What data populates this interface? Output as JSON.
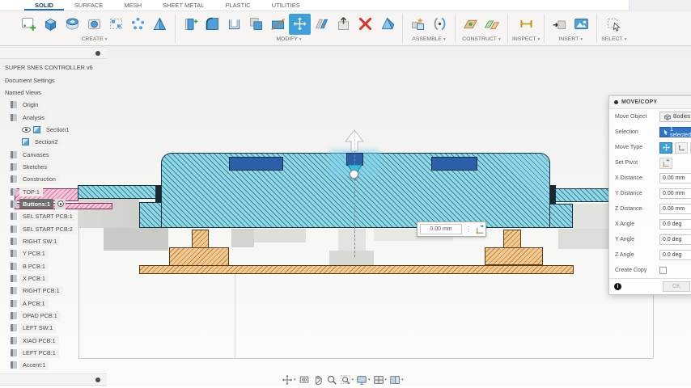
{
  "ribbon": {
    "tabs": [
      {
        "label": "SOLID",
        "active": true
      },
      {
        "label": "SURFACE",
        "active": false
      },
      {
        "label": "MESH",
        "active": false
      },
      {
        "label": "SHEET METAL",
        "active": false
      },
      {
        "label": "PLASTIC",
        "active": false
      },
      {
        "label": "UTILITIES",
        "active": false
      }
    ],
    "groups": [
      {
        "label": "CREATE"
      },
      {
        "label": "MODIFY"
      },
      {
        "label": "ASSEMBLE"
      },
      {
        "label": "CONSTRUCT"
      },
      {
        "label": "INSPECT"
      },
      {
        "label": "INSERT"
      },
      {
        "label": "SELECT"
      }
    ]
  },
  "browser": {
    "items": [
      {
        "label": "SUPER SNES CONTROLLER v6",
        "type": "doc"
      },
      {
        "label": "Document Settings",
        "type": "folder"
      },
      {
        "label": "Named Views",
        "type": "folder"
      },
      {
        "label": "Origin",
        "type": "node"
      },
      {
        "label": "Analysis",
        "type": "node"
      },
      {
        "label": "Section1",
        "type": "section",
        "eye": true
      },
      {
        "label": "Section2",
        "type": "section",
        "eye": false
      },
      {
        "label": "Canvases",
        "type": "node"
      },
      {
        "label": "Sketches",
        "type": "node"
      },
      {
        "label": "Construction",
        "type": "node"
      },
      {
        "label": "TOP:1",
        "type": "component"
      },
      {
        "label": "Buttons:1",
        "type": "component",
        "selected": true
      },
      {
        "label": "SEL START PCB:1",
        "type": "component"
      },
      {
        "label": "SEL START PCB:2",
        "type": "component"
      },
      {
        "label": "RIGHT SW:1",
        "type": "component"
      },
      {
        "label": "Y PCB:1",
        "type": "component"
      },
      {
        "label": "B PCB:1",
        "type": "component"
      },
      {
        "label": "X PCB:1",
        "type": "component"
      },
      {
        "label": "RIGHT PCB:1",
        "type": "component"
      },
      {
        "label": "A PCB:1",
        "type": "component"
      },
      {
        "label": "DPAD PCB:1",
        "type": "component"
      },
      {
        "label": "LEFT SW:1",
        "type": "component"
      },
      {
        "label": "XIAO PCB:1",
        "type": "component"
      },
      {
        "label": "LEFT PCB:1",
        "type": "component"
      },
      {
        "label": "Accent:1",
        "type": "component"
      }
    ]
  },
  "dialog": {
    "title": "MOVE/COPY",
    "rows": [
      {
        "label": "Move Object",
        "type": "object-button",
        "value": "Bodies"
      },
      {
        "label": "Selection",
        "type": "selection-chip",
        "value": "1 selected"
      },
      {
        "label": "Move Type",
        "type": "move-type-icons"
      },
      {
        "label": "Set Pivot",
        "type": "pivot-button"
      },
      {
        "label": "X Distance",
        "type": "input",
        "value": "0.00 mm"
      },
      {
        "label": "Y Distance",
        "type": "input",
        "value": "0.00 mm"
      },
      {
        "label": "Z Distance",
        "type": "input",
        "value": "0.00 mm"
      },
      {
        "label": "X Angle",
        "type": "input",
        "value": "0.0 deg"
      },
      {
        "label": "Y Angle",
        "type": "input",
        "value": "0.0 deg"
      },
      {
        "label": "Z Angle",
        "type": "input",
        "value": "0.0 deg"
      },
      {
        "label": "Create Copy",
        "type": "checkbox",
        "checked": false
      }
    ],
    "ok_label": "OK"
  },
  "canvas_input": {
    "value": "0.00 mm"
  },
  "colors": {
    "accent_blue": "#1f72b8",
    "active_tool": "#3f9fd8",
    "selection_chip": "#3076c8",
    "section_cyan": "#8fd8e8",
    "section_tan": "#f2c98e",
    "section_pink": "#f6c3da",
    "button_blue": "#2b5fa8",
    "delete_red": "#d9342b"
  }
}
